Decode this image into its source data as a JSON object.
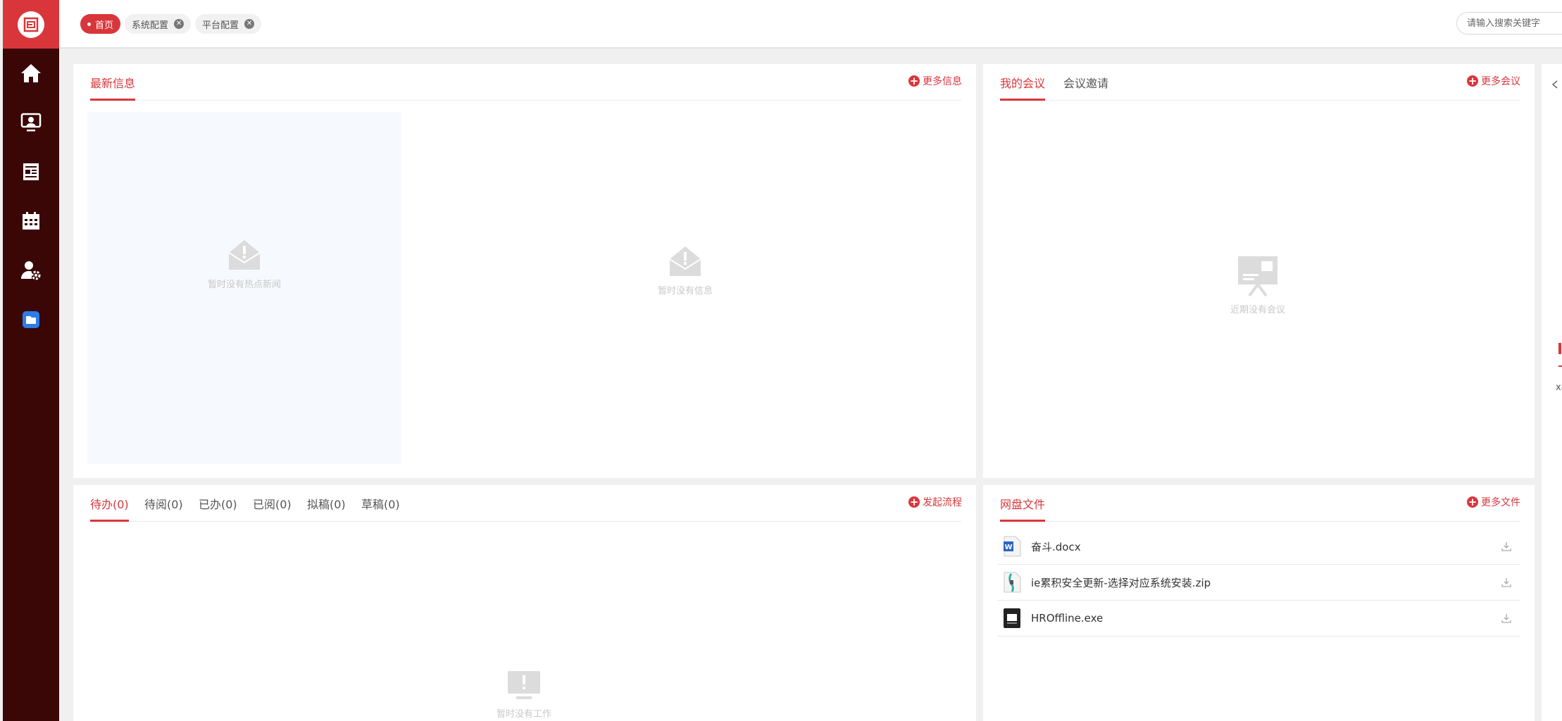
{
  "topbar": {
    "tabs": [
      {
        "label": "首页",
        "active": true
      },
      {
        "label": "系统配置",
        "active": false
      },
      {
        "label": "平台配置",
        "active": false
      }
    ],
    "search_placeholder": "请输入搜索关键字"
  },
  "sidebar": {
    "items": [
      "home-icon",
      "monitor-user-icon",
      "news-icon",
      "calendar-icon",
      "user-settings-icon",
      "folder-icon"
    ]
  },
  "news_panel": {
    "tab": "最新信息",
    "more": "更多信息",
    "hot_empty": "暂时没有热点新闻",
    "info_empty": "暂时没有信息"
  },
  "meeting_panel": {
    "tabs": [
      "我的会议",
      "会议邀请"
    ],
    "more": "更多会议",
    "empty": "近期没有会议"
  },
  "work_panel": {
    "tabs": [
      "待办(0)",
      "待阅(0)",
      "已办(0)",
      "已阅(0)",
      "拟稿(0)",
      "草稿(0)"
    ],
    "more": "发起流程",
    "empty": "暂时没有工作"
  },
  "files_panel": {
    "tab": "网盘文件",
    "more": "更多文件",
    "files": [
      {
        "name": "奋斗.docx",
        "type": "docx"
      },
      {
        "name": "ie累积安全更新-选择对应系统安装.zip",
        "type": "zip"
      },
      {
        "name": "HROffline.exe",
        "type": "exe"
      }
    ]
  },
  "edge_panel": {
    "text": "xa"
  },
  "colors": {
    "brand": "#d9363b",
    "sidebar": "#3a0606"
  }
}
